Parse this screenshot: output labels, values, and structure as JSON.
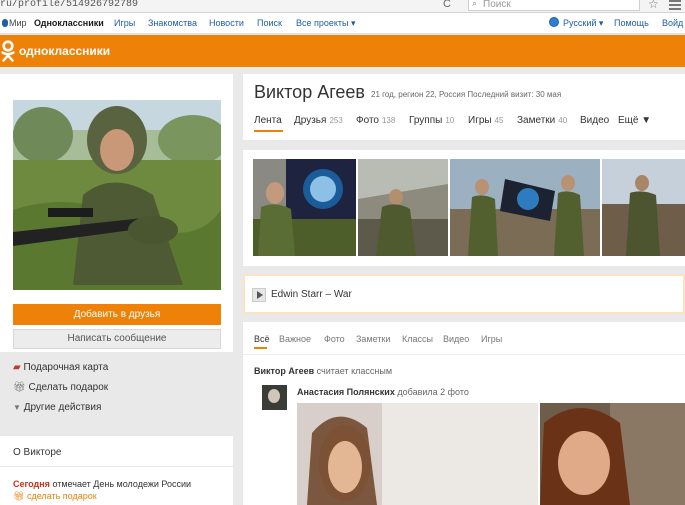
{
  "browser": {
    "url": "ru/profile/514926792789",
    "search_placeholder": "Поиск"
  },
  "portal": {
    "links": [
      "Мир",
      "Одноклассники",
      "Игры",
      "Знакомства",
      "Новости",
      "Поиск",
      "Все проекты ▾"
    ],
    "language": "Русский ▾",
    "help": "Помощь",
    "login": "Войд"
  },
  "site": {
    "title": "одноклассники",
    "accent": "#ee8208"
  },
  "profile": {
    "name": "Виктор Агеев",
    "meta": "21 год, регион 22, Россия  Последний визит: 30 мая",
    "tabs": [
      {
        "label": "Лента",
        "count": ""
      },
      {
        "label": "Друзья",
        "count": "253"
      },
      {
        "label": "Фото",
        "count": "138"
      },
      {
        "label": "Группы",
        "count": "10"
      },
      {
        "label": "Игры",
        "count": "45"
      },
      {
        "label": "Заметки",
        "count": "40"
      },
      {
        "label": "Видео",
        "count": ""
      },
      {
        "label": "Ещё ▼",
        "count": ""
      }
    ]
  },
  "left": {
    "add_friend": "Добавить в друзья",
    "write_message": "Написать сообщение",
    "actions": [
      {
        "icon": "gift-card-icon",
        "label": "Подарочная карта"
      },
      {
        "icon": "gift-icon",
        "label": "Сделать подарок"
      },
      {
        "icon": "chevron-down-icon",
        "label": "Другие действия"
      }
    ],
    "about_title": "О Викторе",
    "today_label": "Сегодня",
    "today_text": "отмечает День молодежи России",
    "gift_link": "сделать подарок"
  },
  "music": {
    "artist": "Edwin Starr",
    "separator": "–",
    "track": "War"
  },
  "feed": {
    "tabs": [
      "Всё",
      "Важное",
      "Фото",
      "Заметки",
      "Классы",
      "Видео",
      "Игры"
    ],
    "liked_user": "Виктор Агеев",
    "liked_text": "считает классным",
    "post_author": "Анастасия Полянских",
    "post_action": "добавила 2 фото"
  }
}
